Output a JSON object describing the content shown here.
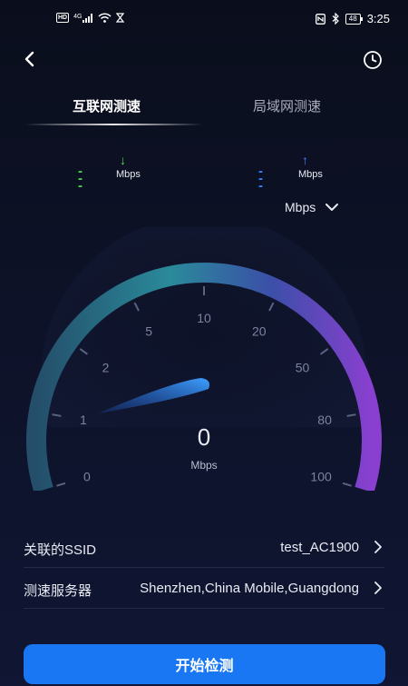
{
  "status_bar": {
    "left_icons": [
      "hd-icon",
      "signal-4g-icon",
      "wifi-icon",
      "hourglass-icon"
    ],
    "hd_label": "HD",
    "network_label": "4G",
    "right_icons": [
      "nfc-icon",
      "bluetooth-icon",
      "battery-icon"
    ],
    "battery_level": "48",
    "time": "3:25"
  },
  "header": {
    "back_icon": "chevron-left-icon",
    "history_icon": "clock-icon"
  },
  "tabs": [
    {
      "label": "互联网测速",
      "active": true
    },
    {
      "label": "局域网测速",
      "active": false
    }
  ],
  "rates": {
    "download": {
      "value": "---",
      "unit": "Mbps",
      "arrow": "↓",
      "color": "#4fd75a"
    },
    "upload": {
      "value": "---",
      "unit": "Mbps",
      "arrow": "↑",
      "color": "#3a86ff"
    }
  },
  "unit_selector": {
    "value": "Mbps",
    "icon": "chevron-down-icon"
  },
  "gauge": {
    "tick_labels": [
      "0",
      "1",
      "2",
      "5",
      "10",
      "20",
      "50",
      "80",
      "100"
    ],
    "current_speed": "0",
    "unit": "Mbps",
    "needle_value": 0
  },
  "info_rows": [
    {
      "label": "关联的SSID",
      "value": "test_AC1900"
    },
    {
      "label": "测速服务器",
      "value": "Shenzhen,China Mobile,Guangdong"
    }
  ],
  "start_button": {
    "label": "开始检测"
  },
  "colors": {
    "accent": "#1977f3",
    "download": "#4fd75a",
    "upload": "#3a86ff",
    "gauge_left": "#2a8a9a",
    "gauge_right": "#8a3fd0"
  }
}
